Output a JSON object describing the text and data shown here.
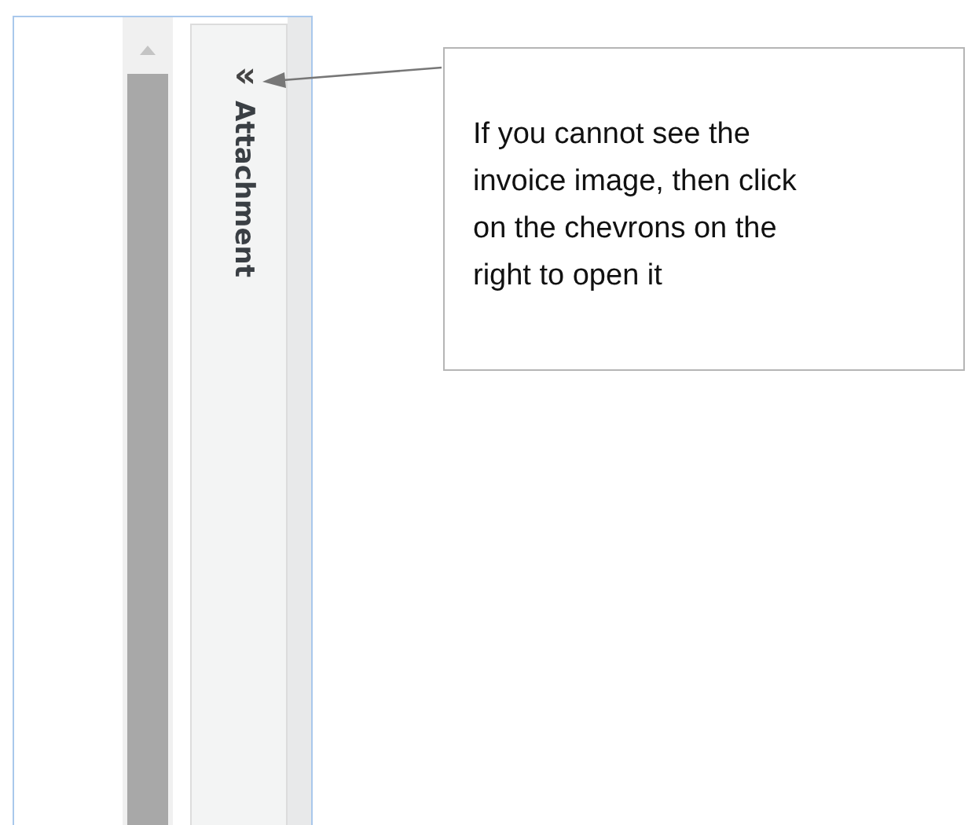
{
  "attachment_panel": {
    "toggle": "«",
    "title": "Attachment"
  },
  "callout": {
    "text": "If you cannot see the\ninvoice image, then click\non the chevrons on the\nright to open it"
  }
}
